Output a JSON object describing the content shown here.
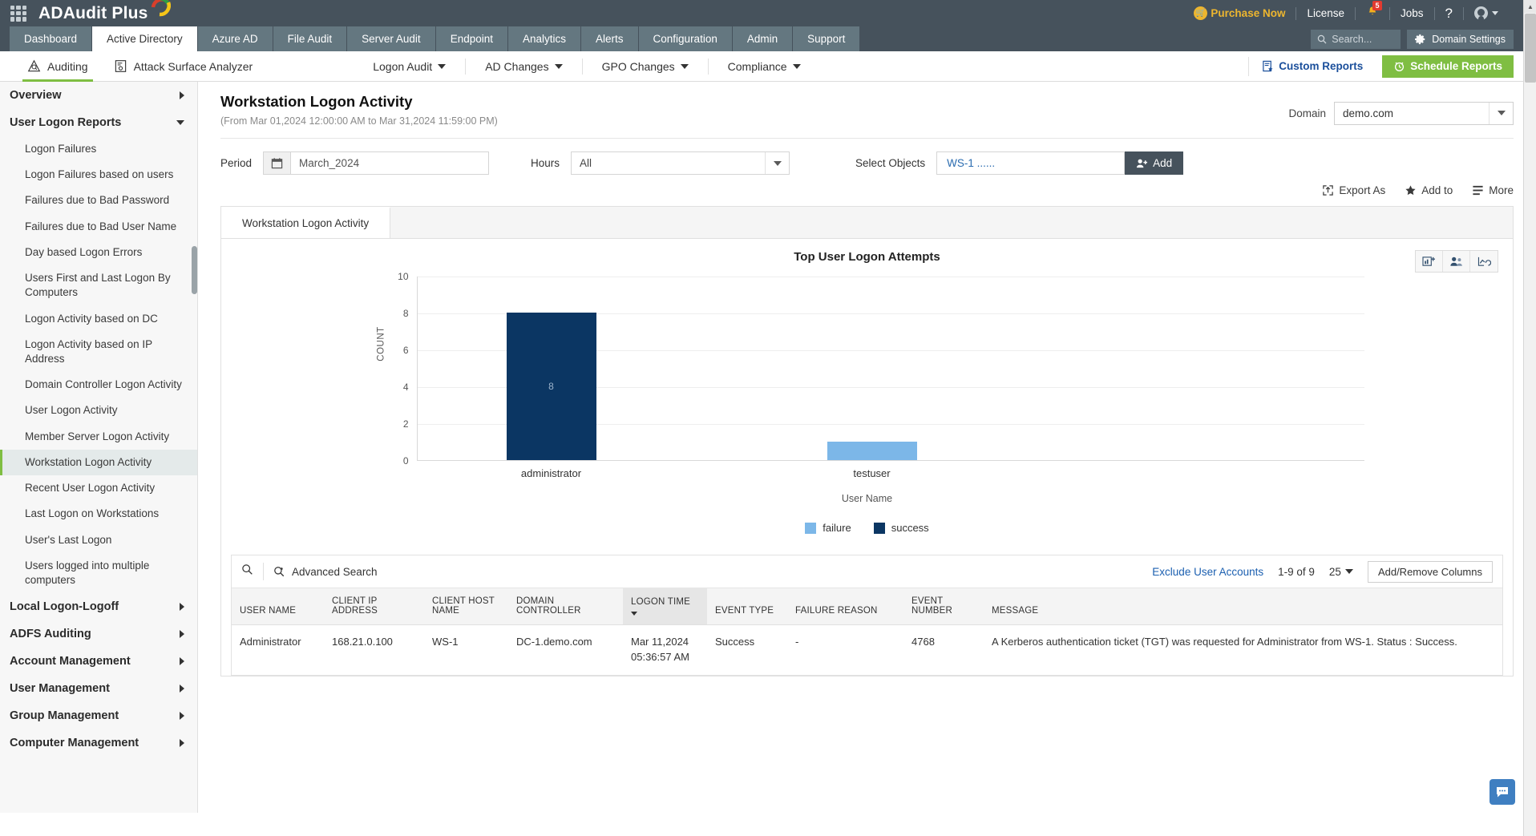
{
  "topbar": {
    "brand": "ADAudit Plus",
    "grid_icon": "apps-grid-icon",
    "purchase": "Purchase Now",
    "license": "License",
    "notifications_count": "5",
    "jobs": "Jobs",
    "help": "?"
  },
  "main_tabs": [
    {
      "label": "Dashboard",
      "active": false
    },
    {
      "label": "Active Directory",
      "active": true
    },
    {
      "label": "Azure AD",
      "active": false
    },
    {
      "label": "File Audit",
      "active": false
    },
    {
      "label": "Server Audit",
      "active": false
    },
    {
      "label": "Endpoint",
      "active": false
    },
    {
      "label": "Analytics",
      "active": false
    },
    {
      "label": "Alerts",
      "active": false
    },
    {
      "label": "Configuration",
      "active": false
    },
    {
      "label": "Admin",
      "active": false
    },
    {
      "label": "Support",
      "active": false
    }
  ],
  "main_tabs_right": {
    "search_placeholder": "Search...",
    "domain_settings": "Domain Settings"
  },
  "subnav": {
    "left": [
      {
        "label": "Auditing",
        "icon": "auditing-icon",
        "active": true
      },
      {
        "label": "Attack Surface Analyzer",
        "icon": "analyzer-icon",
        "active": false
      }
    ],
    "dropdowns": [
      {
        "label": "Logon Audit"
      },
      {
        "label": "AD Changes"
      },
      {
        "label": "GPO Changes"
      },
      {
        "label": "Compliance"
      }
    ],
    "custom_reports": "Custom Reports",
    "schedule_reports": "Schedule Reports"
  },
  "sidebar": {
    "groups": [
      {
        "label": "Overview",
        "bold": true,
        "state": "collapsed"
      },
      {
        "label": "User Logon Reports",
        "bold": true,
        "state": "expanded"
      }
    ],
    "items": [
      {
        "label": "Logon Failures",
        "selected": false
      },
      {
        "label": "Logon Failures based on users",
        "selected": false
      },
      {
        "label": "Failures due to Bad Password",
        "selected": false
      },
      {
        "label": "Failures due to Bad User Name",
        "selected": false
      },
      {
        "label": "Day based Logon Errors",
        "selected": false
      },
      {
        "label": "Users First and Last Logon By Computers",
        "selected": false
      },
      {
        "label": "Logon Activity based on DC",
        "selected": false
      },
      {
        "label": "Logon Activity based on IP Address",
        "selected": false
      },
      {
        "label": "Domain Controller Logon Activity",
        "selected": false
      },
      {
        "label": "User Logon Activity",
        "selected": false
      },
      {
        "label": "Member Server Logon Activity",
        "selected": false
      },
      {
        "label": "Workstation Logon Activity",
        "selected": true
      },
      {
        "label": "Recent User Logon Activity",
        "selected": false
      },
      {
        "label": "Last Logon on Workstations",
        "selected": false
      },
      {
        "label": "User's Last Logon",
        "selected": false
      },
      {
        "label": "Users logged into multiple computers",
        "selected": false
      }
    ],
    "bottom_groups": [
      {
        "label": "Local Logon-Logoff"
      },
      {
        "label": "ADFS Auditing"
      },
      {
        "label": "Account Management"
      },
      {
        "label": "User Management"
      },
      {
        "label": "Group Management"
      },
      {
        "label": "Computer Management"
      }
    ]
  },
  "page": {
    "title": "Workstation Logon Activity",
    "subtitle": "(From Mar 01,2024 12:00:00 AM to Mar 31,2024 11:59:00 PM)",
    "domain_label": "Domain",
    "domain_value": "demo.com"
  },
  "filters": {
    "period_label": "Period",
    "period_value": "March_2024",
    "hours_label": "Hours",
    "hours_value": "All",
    "objects_label": "Select Objects",
    "objects_value": "WS-1 ......",
    "add_button": "Add"
  },
  "actions": {
    "export_as": "Export As",
    "add_to": "Add to",
    "more": "More"
  },
  "report": {
    "tab_label": "Workstation Logon Activity",
    "tools": [
      "add-chart-icon",
      "user-chart-icon",
      "line-chart-icon"
    ]
  },
  "chart_data": {
    "type": "bar",
    "title": "Top User Logon Attempts",
    "xlabel": "User Name",
    "ylabel": "COUNT",
    "categories": [
      "administrator",
      "testuser"
    ],
    "yticks": [
      0,
      2,
      4,
      6,
      8,
      10
    ],
    "ylim": [
      0,
      10
    ],
    "grid": true,
    "legend_position": "bottom",
    "series": [
      {
        "name": "failure",
        "color": "#7cb7e8",
        "values": [
          0,
          1
        ]
      },
      {
        "name": "success",
        "color": "#0b3663",
        "values": [
          8,
          0
        ]
      }
    ],
    "bar_labels": [
      {
        "category": "administrator",
        "series": "success",
        "value": 8
      },
      {
        "category": "testuser",
        "series": "failure",
        "value": 1
      }
    ]
  },
  "table": {
    "advanced_search": "Advanced Search",
    "exclude_user_accounts": "Exclude User Accounts",
    "page_info": "1-9 of 9",
    "page_size": "25",
    "add_remove_columns": "Add/Remove Columns",
    "columns": [
      {
        "label": "USER NAME",
        "sorted": false
      },
      {
        "label": "CLIENT IP ADDRESS",
        "sorted": false
      },
      {
        "label": "CLIENT HOST NAME",
        "sorted": false
      },
      {
        "label": "DOMAIN CONTROLLER",
        "sorted": false
      },
      {
        "label": "LOGON TIME",
        "sorted": true
      },
      {
        "label": "EVENT TYPE",
        "sorted": false
      },
      {
        "label": "FAILURE REASON",
        "sorted": false
      },
      {
        "label": "EVENT NUMBER",
        "sorted": false
      },
      {
        "label": "MESSAGE",
        "sorted": false
      }
    ],
    "rows": [
      {
        "user_name": "Administrator",
        "client_ip": "168.21.0.100",
        "client_host": "WS-1",
        "domain_controller": "DC-1.demo.com",
        "logon_time": "Mar 11,2024 05:36:57 AM",
        "event_type": "Success",
        "failure_reason": "-",
        "event_number": "4768",
        "message": "A Kerberos authentication ticket (TGT) was requested for Administrator from WS-1. Status : Success."
      }
    ]
  },
  "colors": {
    "header_bg": "#46525c",
    "tab_bg": "#647780",
    "accent_green": "#7fbe42",
    "link_blue": "#1b5fb0",
    "purchase_yellow": "#edb62f",
    "bar_success": "#0b3663",
    "bar_failure": "#7cb7e8"
  }
}
